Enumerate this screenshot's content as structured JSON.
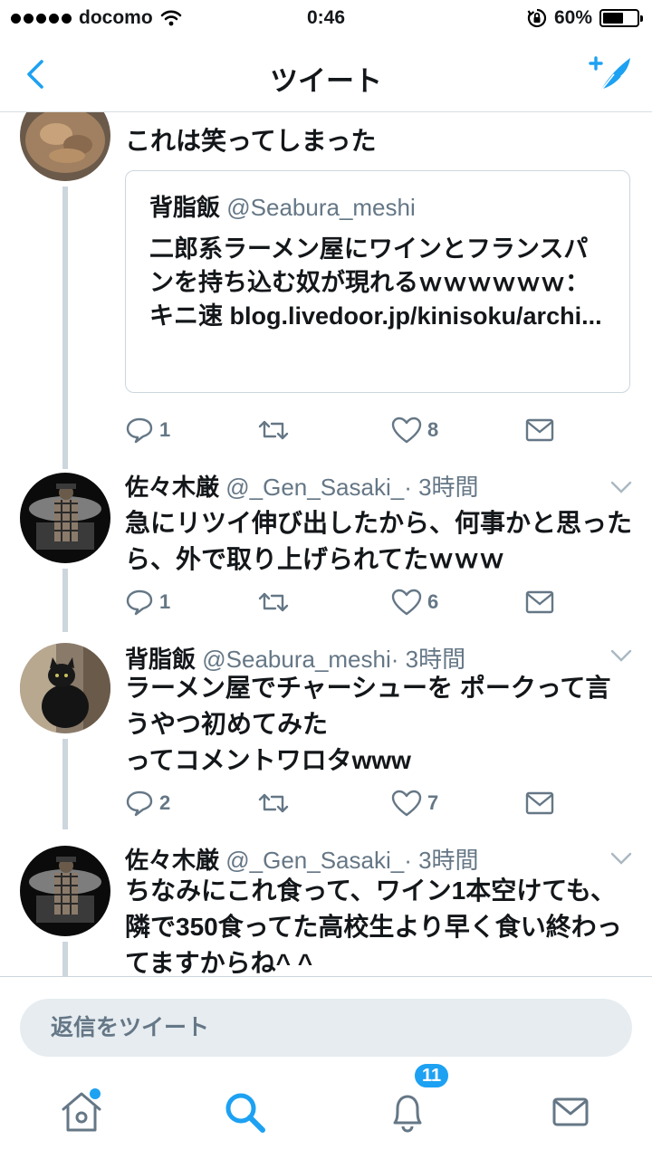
{
  "status_bar": {
    "carrier": "docomo",
    "time": "0:46",
    "battery_percent": "60%",
    "battery_level": 0.6
  },
  "nav": {
    "title": "ツイート",
    "back_icon": "chevron-left-icon",
    "compose_icon": "compose-tweet-icon"
  },
  "tweets": [
    {
      "text": "これは笑ってしまった",
      "quoted": {
        "name": "背脂飯",
        "handle": "@Seabura_meshi",
        "text": "二郎系ラーメン屋にワインとフランスパンを持ち込む奴が現れるｗｗｗｗｗｗ：キニ速 blog.livedoor.jp/kinisoku/archi..."
      },
      "replies": "1",
      "retweets": "",
      "likes": "8"
    },
    {
      "name": "佐々木厳",
      "handle": "@_Gen_Sasaki_",
      "time": "· 3時間",
      "text": "急にリツイ伸び出したから、何事かと思ったら、外で取り上げられてたｗｗｗ",
      "replies": "1",
      "retweets": "",
      "likes": "6"
    },
    {
      "name": "背脂飯",
      "handle": "@Seabura_meshi",
      "time": "· 3時間",
      "text": "ラーメン屋でチャーシューを ポークって言うやつ初めてみた\nってコメントワロタwww",
      "replies": "2",
      "retweets": "",
      "likes": "7"
    },
    {
      "name": "佐々木厳",
      "handle": "@_Gen_Sasaki_",
      "time": "· 3時間",
      "text": "ちなみにこれ食って、ワイン1本空けても、隣で350食ってた高校生より早く食い終わってますからね^ ^"
    }
  ],
  "reply_bar": {
    "placeholder": "返信をツイート"
  },
  "tab_bar": {
    "notifications_badge": "11",
    "tabs": [
      "home-icon",
      "search-icon",
      "notifications-icon",
      "messages-icon"
    ]
  },
  "colors": {
    "accent": "#1da1f2",
    "secondary_text": "#657786",
    "divider": "#ccd6dd"
  }
}
